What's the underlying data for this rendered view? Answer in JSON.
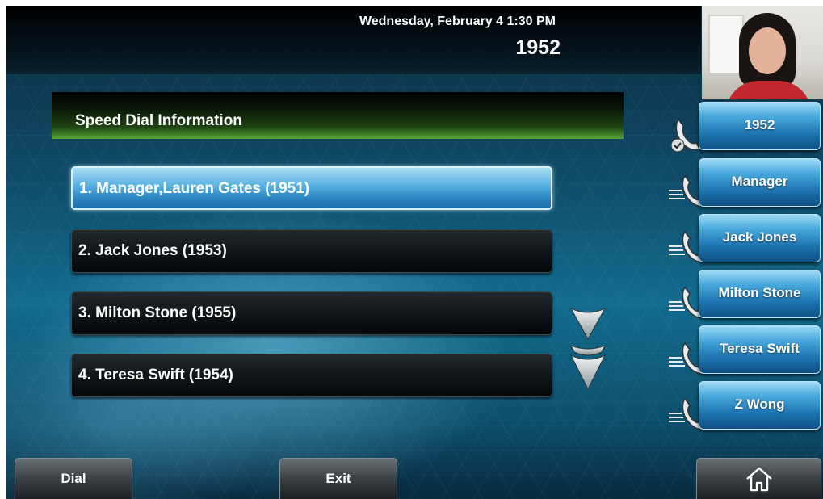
{
  "header": {
    "datetime": "Wednesday, February 4  1:30 PM",
    "line_number": "1952"
  },
  "panel": {
    "title": "Speed Dial Information"
  },
  "speed_dial_list": [
    {
      "label": "1. Manager,Lauren Gates (1951)",
      "selected": true
    },
    {
      "label": "2. Jack Jones (1953)",
      "selected": false
    },
    {
      "label": "3. Milton Stone (1955)",
      "selected": false
    },
    {
      "label": "4. Teresa Swift (1954)",
      "selected": false
    }
  ],
  "line_keys": [
    {
      "label": "1952",
      "icon": "handset-registered-icon"
    },
    {
      "label": "Manager",
      "icon": "speed-dial-handset-icon"
    },
    {
      "label": "Jack Jones",
      "icon": "speed-dial-handset-icon"
    },
    {
      "label": "Milton Stone",
      "icon": "speed-dial-handset-icon"
    },
    {
      "label": "Teresa Swift",
      "icon": "speed-dial-handset-icon"
    },
    {
      "label": "Z Wong",
      "icon": "speed-dial-handset-icon"
    }
  ],
  "softkeys": {
    "dial": "Dial",
    "exit": "Exit",
    "home_icon": "home-icon"
  },
  "icons": {
    "scroll_down": "chevron-down-icon",
    "scroll_to_end": "double-chevron-down-icon",
    "video": "camera-preview"
  },
  "colors": {
    "selected_row": "#48a9dc",
    "line_key": "#1f77b4",
    "title_bar_accent": "#58a632"
  }
}
